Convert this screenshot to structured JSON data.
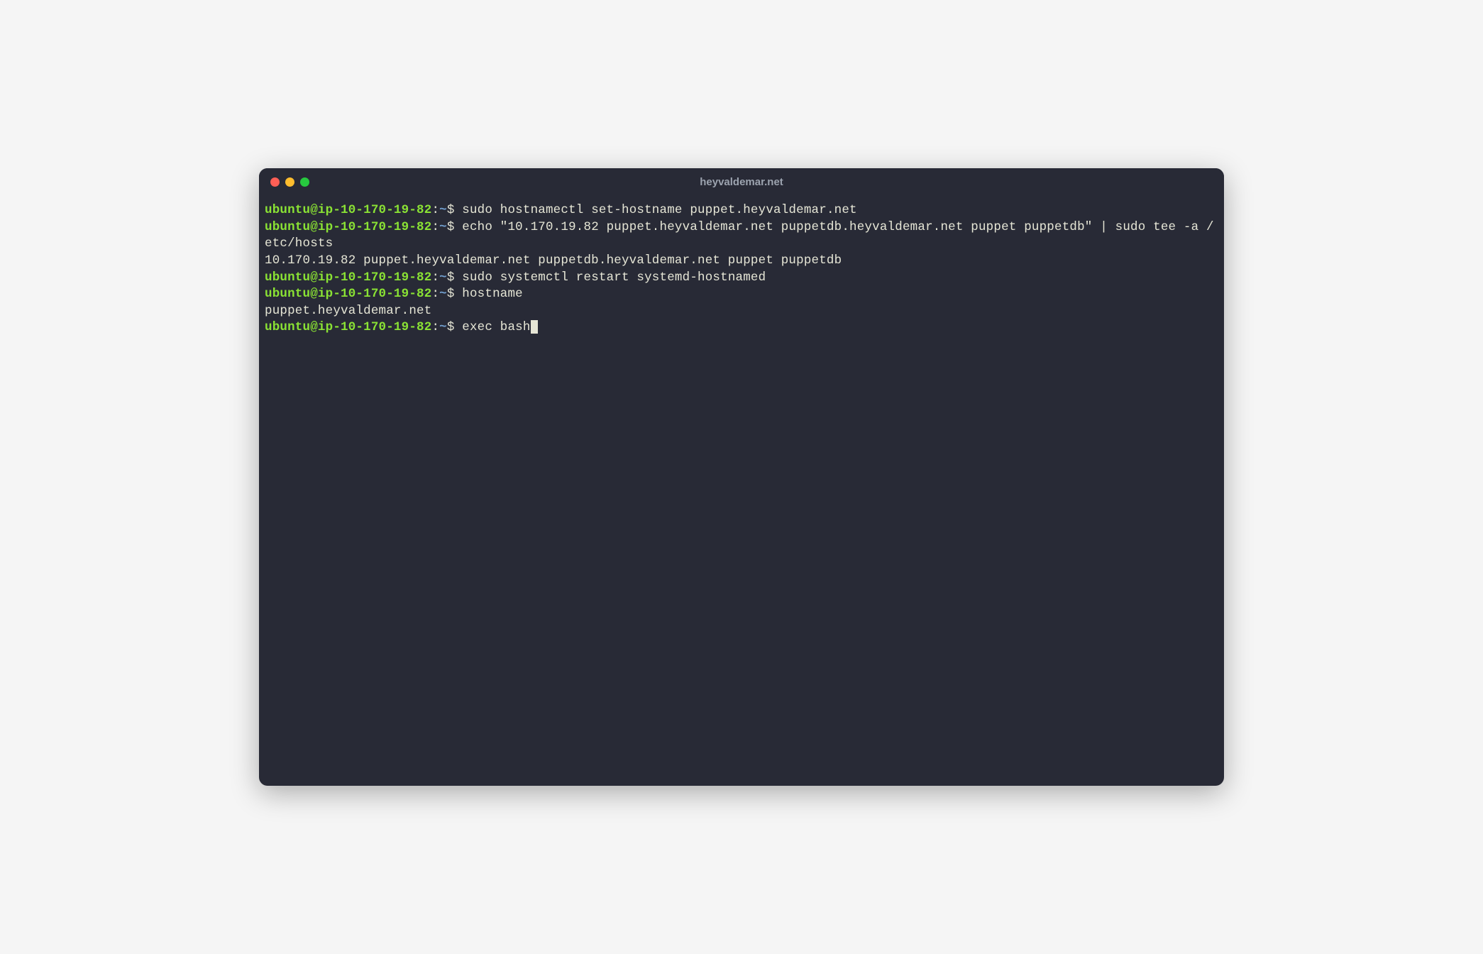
{
  "window": {
    "title": "heyvaldemar.net"
  },
  "prompt": {
    "user_host": "ubuntu@ip-10-170-19-82",
    "colon": ":",
    "path": "~",
    "symbol": "$"
  },
  "lines": {
    "cmd1": " sudo hostnamectl set-hostname puppet.heyvaldemar.net",
    "cmd2": " echo \"10.170.19.82 puppet.heyvaldemar.net puppetdb.heyvaldemar.net puppet puppetdb\" | sudo tee -a /etc/hosts",
    "out2": "10.170.19.82 puppet.heyvaldemar.net puppetdb.heyvaldemar.net puppet puppetdb",
    "cmd3": " sudo systemctl restart systemd-hostnamed",
    "cmd4": " hostname",
    "out4": "puppet.heyvaldemar.net",
    "cmd5": " exec bash"
  }
}
